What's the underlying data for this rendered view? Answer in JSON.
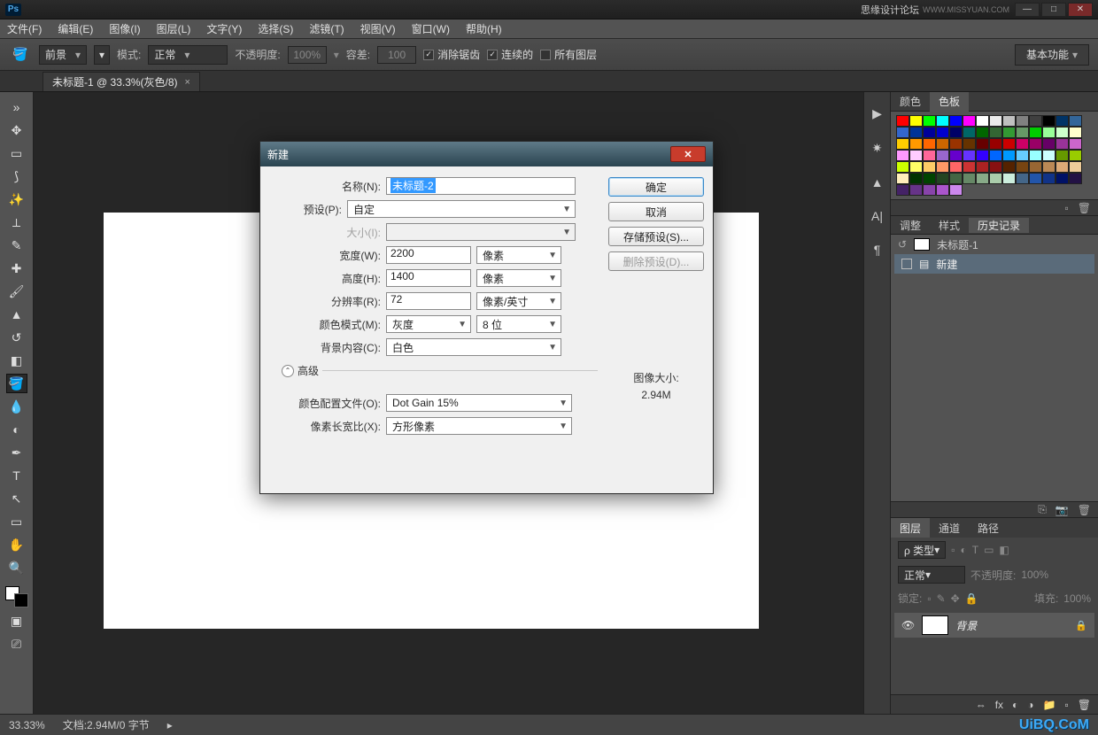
{
  "titlebar": {
    "brand": "思缘设计论坛",
    "suburl": "WWW.MISSYUAN.COM"
  },
  "menu": [
    "文件(F)",
    "编辑(E)",
    "图像(I)",
    "图层(L)",
    "文字(Y)",
    "选择(S)",
    "滤镜(T)",
    "视图(V)",
    "窗口(W)",
    "帮助(H)"
  ],
  "options": {
    "fg": "前景",
    "mode_lab": "模式:",
    "mode_val": "正常",
    "opacity_lab": "不透明度:",
    "opacity_val": "100%",
    "tolerance_lab": "容差:",
    "tolerance_val": "100",
    "antialias": "消除锯齿",
    "contiguous": "连续的",
    "alllayers": "所有图层",
    "workspace": "基本功能"
  },
  "doc_tab": {
    "title": "未标题-1 @ 33.3%(灰色/8)",
    "close": "×"
  },
  "panels": {
    "color_tab": "颜色",
    "swatch_tab": "色板",
    "adjust": "调整",
    "styles": "样式",
    "history": "历史记录",
    "history_doc": "未标题-1",
    "history_new": "新建",
    "layers": "图层",
    "channels": "通道",
    "paths": "路径",
    "layer_type_lab": "ρ 类型",
    "layer_normal": "正常",
    "layer_opacity_lab": "不透明度:",
    "layer_opacity_val": "100%",
    "lock_lab": "锁定:",
    "fill_lab": "填充:",
    "fill_val": "100%",
    "bg_layer": "背景"
  },
  "status": {
    "zoom": "33.33%",
    "docinfo": "文档:2.94M/0 字节",
    "watermark": "UiBQ.CoM"
  },
  "dialog": {
    "title": "新建",
    "name_lab": "名称(N):",
    "name_val": "未标题-2",
    "preset_lab": "预设(P):",
    "preset_val": "自定",
    "size_lab": "大小(I):",
    "width_lab": "宽度(W):",
    "width_val": "2200",
    "width_unit": "像素",
    "height_lab": "高度(H):",
    "height_val": "1400",
    "height_unit": "像素",
    "res_lab": "分辨率(R):",
    "res_val": "72",
    "res_unit": "像素/英寸",
    "mode_lab": "颜色模式(M):",
    "mode_val": "灰度",
    "mode_bits": "8 位",
    "bg_lab": "背景内容(C):",
    "bg_val": "白色",
    "adv": "高级",
    "profile_lab": "颜色配置文件(O):",
    "profile_val": "Dot Gain 15%",
    "aspect_lab": "像素长宽比(X):",
    "aspect_val": "方形像素",
    "ok": "确定",
    "cancel": "取消",
    "savepreset": "存储预设(S)...",
    "delpreset": "删除预设(D)...",
    "size_info_lab": "图像大小:",
    "size_info_val": "2.94M"
  },
  "swatch_colors": [
    "#ff0000",
    "#ffff00",
    "#00ff00",
    "#00ffff",
    "#0000ff",
    "#ff00ff",
    "#ffffff",
    "#eaeaea",
    "#c0c0c0",
    "#808080",
    "#404040",
    "#000000",
    "#003366",
    "#336699",
    "#3366cc",
    "#003399",
    "#000099",
    "#0000cc",
    "#000066",
    "#006666",
    "#006600",
    "#336633",
    "#339933",
    "#669966",
    "#00cc00",
    "#99ff99",
    "#ccffcc",
    "#ffffcc",
    "#ffcc00",
    "#ff9900",
    "#ff6600",
    "#cc6600",
    "#993300",
    "#663300",
    "#660000",
    "#990000",
    "#cc0000",
    "#cc0066",
    "#990066",
    "#660066",
    "#993399",
    "#cc66cc",
    "#ff99ff",
    "#ffccff",
    "#ff6699",
    "#9966cc",
    "#6600cc",
    "#6633ff",
    "#3300ff",
    "#0066ff",
    "#0099ff",
    "#66ccff",
    "#99ffff",
    "#ccffff",
    "#669900",
    "#99cc00",
    "#ccff00",
    "#ffff66",
    "#ffcc66",
    "#ff9966",
    "#ff6666",
    "#cc3333",
    "#aa2222",
    "#881111",
    "#552200",
    "#774411",
    "#996633",
    "#bb8855",
    "#ddaa77",
    "#eecc99",
    "#ffeebb",
    "#003300",
    "#004400",
    "#224422",
    "#446644",
    "#668866",
    "#88aa88",
    "#aaccaa",
    "#cceedd",
    "#446688",
    "#2255aa",
    "#113388",
    "#001166",
    "#221144",
    "#442266",
    "#663388",
    "#8844aa",
    "#aa55cc",
    "#cc88ee"
  ]
}
